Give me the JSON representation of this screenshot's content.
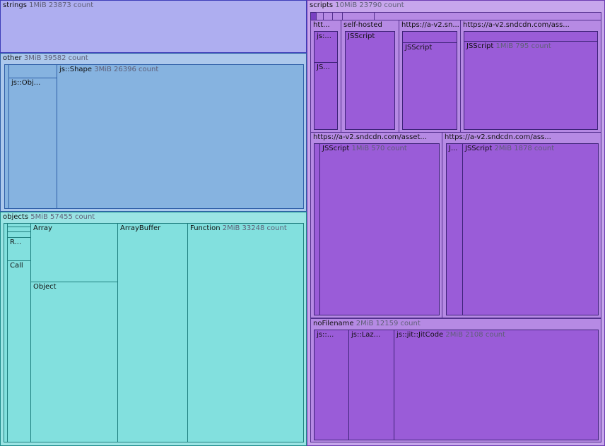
{
  "strings": {
    "name": "strings",
    "meta": "1MiB 23873 count"
  },
  "other": {
    "name": "other",
    "meta": "3MiB 39582 count",
    "js_obj": "js::Obj...",
    "js_shape": {
      "name": "js::Shape",
      "meta": "3MiB 26396 count"
    }
  },
  "objects": {
    "name": "objects",
    "meta": "5MiB 57455 count",
    "r": "R...",
    "call": "Call",
    "array": "Array",
    "object": "Object",
    "arraybuffer": "ArrayBuffer",
    "function": {
      "name": "Function",
      "meta": "2MiB 33248 count"
    }
  },
  "scripts": {
    "name": "scripts",
    "meta": "10MiB 23790 count",
    "htt": "htt...",
    "htt_js1": "js:...",
    "htt_js2": "JS...",
    "selfhosted": "self-hosted",
    "selfhosted_js": "JSScript",
    "asn1": "https://a-v2.sn...",
    "asn1_js": "JSScript",
    "asn2": "https://a-v2.sndcdn.com/ass...",
    "asn2_js": {
      "name": "JSScript",
      "meta": "1MiB 795 count"
    },
    "asset3": "https://a-v2.sndcdn.com/asset...",
    "asset3_j": "",
    "asset3_js": {
      "name": "JSScript",
      "meta": "1MiB 570 count"
    },
    "asset4": "https://a-v2.sndcdn.com/ass...",
    "asset4_j": "J...",
    "asset4_js": {
      "name": "JSScript",
      "meta": "2MiB 1878 count"
    },
    "nofile": {
      "name": "noFilename",
      "meta": "2MiB 12159 count"
    },
    "nofile_js": "js::...",
    "nofile_laz": "js::Laz...",
    "nofile_jit": {
      "name": "js::jit::JitCode",
      "meta": "2MiB 2108 count"
    }
  }
}
